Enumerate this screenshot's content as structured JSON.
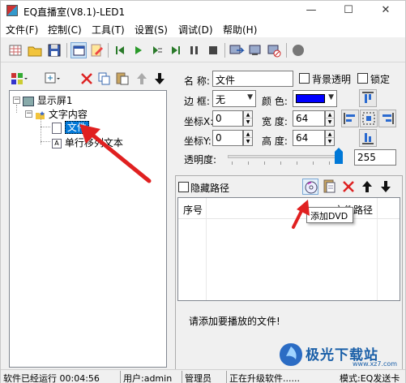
{
  "window": {
    "title": "EQ直播室(V8.1)-LED1",
    "minimize": "—",
    "maximize": "☐",
    "close": "✕"
  },
  "menu": {
    "items": [
      "文件(F)",
      "控制(C)",
      "工具(T)",
      "设置(S)",
      "调试(D)",
      "帮助(H)"
    ]
  },
  "tree": {
    "root": "显示屏1",
    "child": "文字内容",
    "leaf_selected": "文件",
    "leaf_other": "单行移列文本"
  },
  "properties": {
    "name_label": "名  称:",
    "name_value": "文件",
    "bg_transparent_label": "背景透明",
    "lock_label": "锁定",
    "border_label": "边  框:",
    "border_value": "无",
    "color_label": "颜  色:",
    "color_value": "#0000ff",
    "x_label": "坐标X:",
    "x_value": "0",
    "width_label": "宽  度:",
    "width_value": "64",
    "y_label": "坐标Y:",
    "y_value": "0",
    "height_label": "高  度:",
    "height_value": "64",
    "opacity_label": "透明度:",
    "opacity_value": "255"
  },
  "playlist": {
    "hide_path_label": "隐藏路径",
    "col_index": "序号",
    "col_path": "文件路径",
    "tooltip": "添加DVD",
    "hint": "请添加要播放的文件!"
  },
  "status": {
    "running": "软件已经运行 00:04:56",
    "user": "用户:admin",
    "role": "管理员",
    "upgrading": "正在升级软件......",
    "mode": "模式:EQ发送卡"
  },
  "watermark": {
    "text": "极光下载站",
    "url": "www.xz7.com"
  },
  "colors": {
    "accent": "#0078d7",
    "annotation": "#e02020"
  }
}
